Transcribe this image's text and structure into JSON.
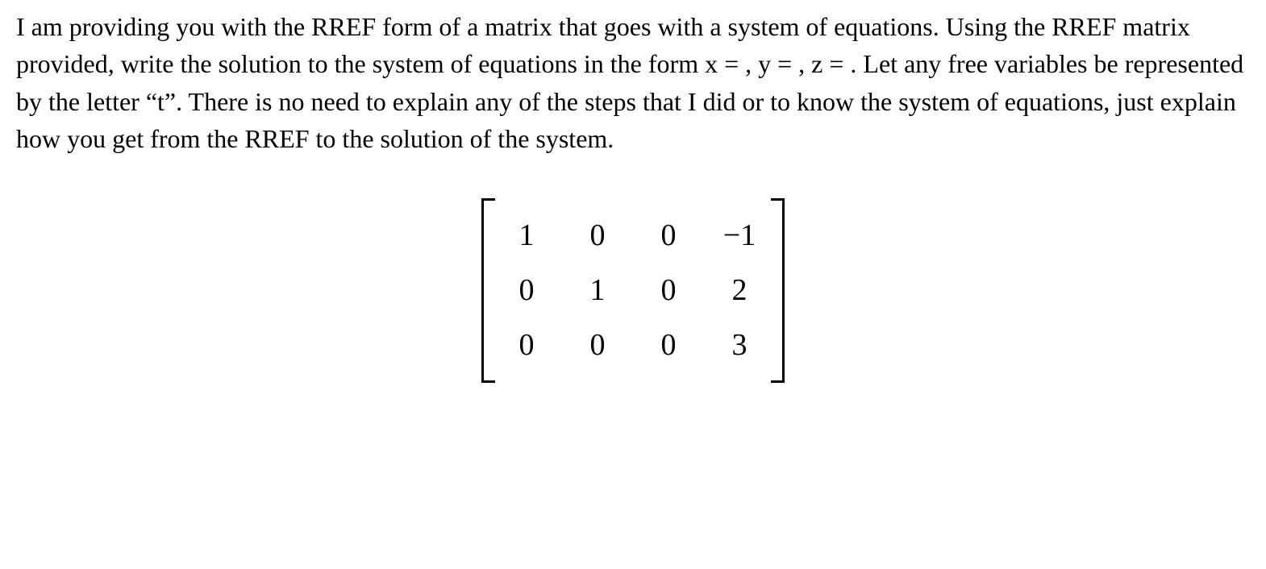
{
  "problem": {
    "text": "I am providing you with the RREF form of a matrix that goes with a system of equations. Using the RREF matrix provided, write the solution to the system of equations in the form x = , y =  ,  z = .  Let any free variables be represented by the letter “t”. There is no need to explain any of the steps that I did or to know the system of equations, just explain how you get from the RREF to the solution of the system."
  },
  "matrix": {
    "rows": [
      [
        "1",
        "0",
        "0",
        "−1"
      ],
      [
        "0",
        "1",
        "0",
        "2"
      ],
      [
        "0",
        "0",
        "0",
        "3"
      ]
    ]
  }
}
